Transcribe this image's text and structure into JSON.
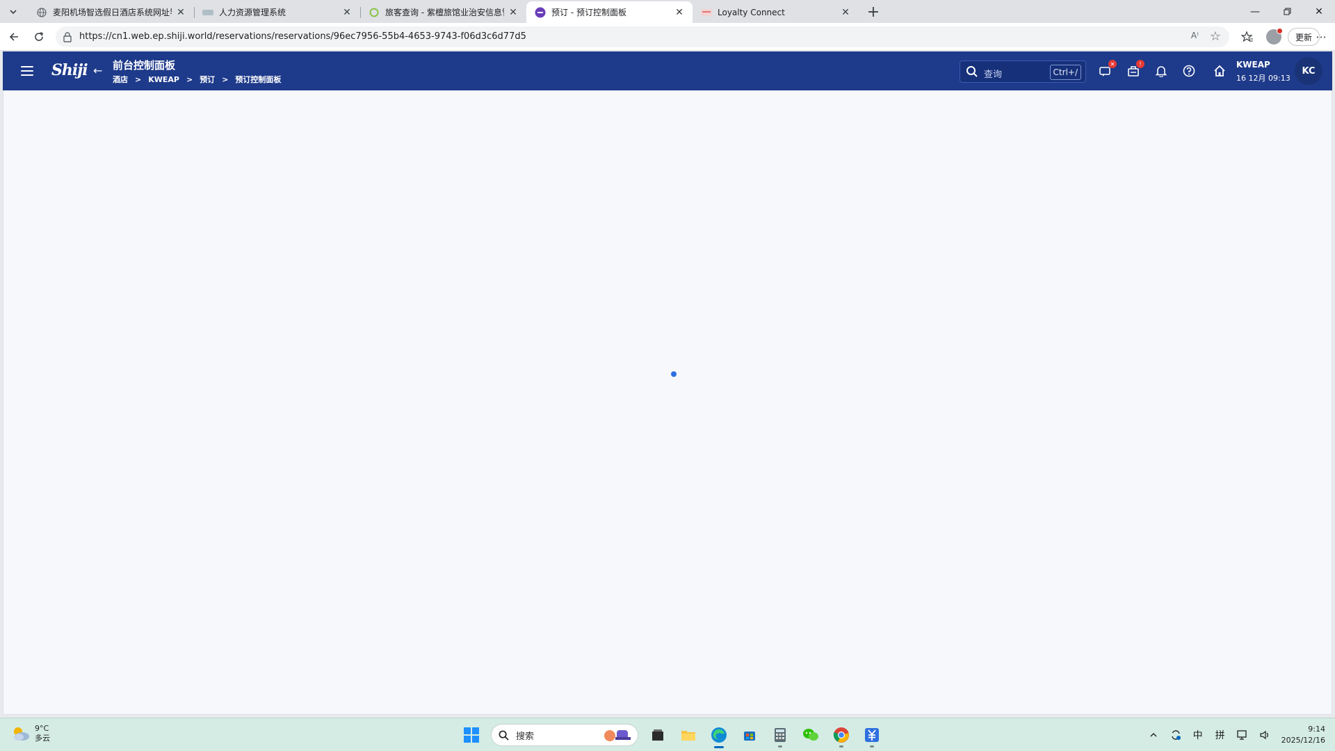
{
  "browser": {
    "tabs": [
      {
        "title": "麦阳机场智选假日酒店系统网址导航",
        "active": false
      },
      {
        "title": "人力资源管理系统",
        "active": false
      },
      {
        "title": "旅客查询 - 紫檀旅馆业治安信息管理",
        "active": false
      },
      {
        "title": "预订 - 预订控制面板",
        "active": true
      },
      {
        "title": "Loyalty Connect",
        "active": false
      }
    ],
    "url": "https://cn1.web.ep.shiji.world/reservations/reservations/96ec7956-55b4-4653-9743-f06d3c6d77d5",
    "read_aloud_label": "A⁾",
    "update_label": "更新"
  },
  "app": {
    "logo": "Shiji",
    "title": "前台控制面板",
    "breadcrumb": [
      "酒店",
      "KWEAP",
      "预订",
      "预订控制面板"
    ],
    "search_placeholder": "查询",
    "search_shortcut": "Ctrl+/",
    "hotel_code": "KWEAP",
    "hotel_datetime": "16 12月 09:13",
    "user_initials": "KC",
    "accent_color": "#1e3a8a"
  },
  "taskbar": {
    "weather_temp": "9°C",
    "weather_desc": "多云",
    "search_label": "搜索",
    "ime_lang": "中",
    "ime_mode": "拼",
    "time": "9:14",
    "date": "2025/12/16"
  }
}
